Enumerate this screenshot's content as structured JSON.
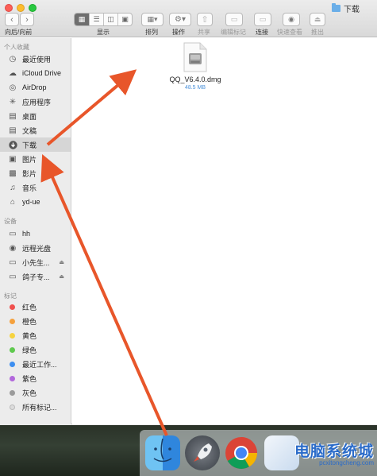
{
  "window": {
    "title": "下载"
  },
  "toolbar": {
    "nav_label": "向后/向前",
    "view_label": "显示",
    "arrange_label": "排列",
    "action_label": "操作",
    "share_label": "共享",
    "tags_label": "编辑标记",
    "connect_label": "连接",
    "quicklook_label": "快速查看",
    "eject_label": "推出"
  },
  "sidebar": {
    "favorites_title": "个人收藏",
    "favorites": [
      {
        "label": "最近使用",
        "icon": "clock-icon"
      },
      {
        "label": "iCloud Drive",
        "icon": "cloud-icon"
      },
      {
        "label": "AirDrop",
        "icon": "airdrop-icon"
      },
      {
        "label": "应用程序",
        "icon": "apps-icon"
      },
      {
        "label": "桌面",
        "icon": "desktop-icon"
      },
      {
        "label": "文稿",
        "icon": "document-icon"
      },
      {
        "label": "下载",
        "icon": "download-icon"
      },
      {
        "label": "图片",
        "icon": "camera-icon"
      },
      {
        "label": "影片",
        "icon": "film-icon"
      },
      {
        "label": "音乐",
        "icon": "music-icon"
      },
      {
        "label": "yd-ue",
        "icon": "home-icon"
      }
    ],
    "devices_title": "设备",
    "devices": [
      {
        "label": "hh",
        "icon": "computer-icon"
      },
      {
        "label": "远程光盘",
        "icon": "disc-icon"
      },
      {
        "label": "小先生...",
        "icon": "drive-icon"
      },
      {
        "label": "鸽子专...",
        "icon": "drive-icon"
      }
    ],
    "tags_title": "标记",
    "tags": [
      {
        "label": "红色",
        "color": "#f0504d"
      },
      {
        "label": "橙色",
        "color": "#f5a13c"
      },
      {
        "label": "黄色",
        "color": "#f6d33f"
      },
      {
        "label": "绿色",
        "color": "#5fc94e"
      },
      {
        "label": "最近工作...",
        "color": "#3d8ef0"
      },
      {
        "label": "紫色",
        "color": "#b268dc"
      },
      {
        "label": "灰色",
        "color": "#9b9b9b"
      },
      {
        "label": "所有标记...",
        "color": "#dcdcdc"
      }
    ]
  },
  "content": {
    "file_name": "QQ_V6.4.0.dmg",
    "file_size": "48.5 MB"
  },
  "watermark": {
    "main": "电脑系统城",
    "sub": "pcxitongcheng.com"
  },
  "colors": {
    "arrow": "#e8562a",
    "selection": "#d6d6d6"
  }
}
